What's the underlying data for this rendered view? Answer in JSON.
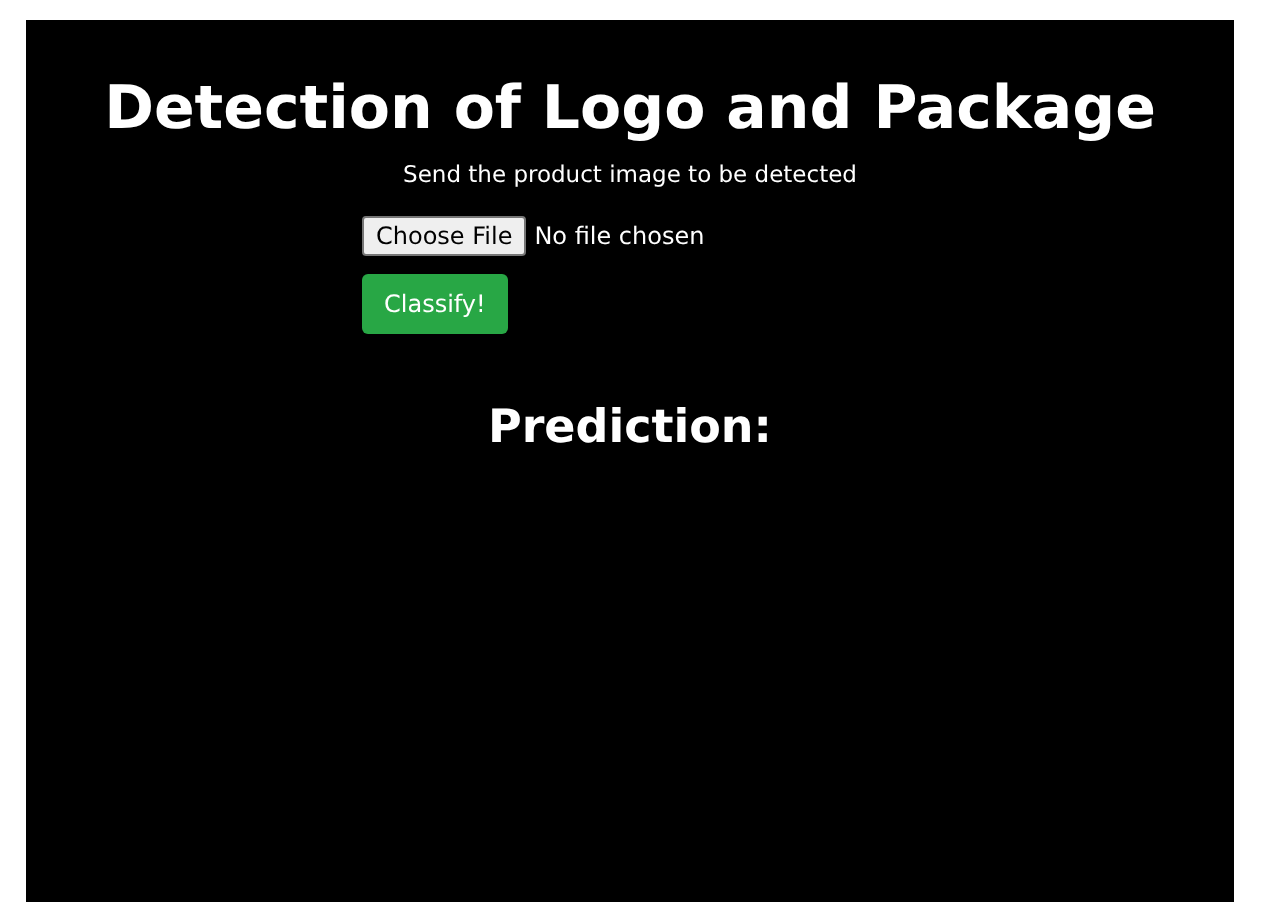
{
  "title": "Detection of Logo and Package",
  "subtitle": "Send the product image to be detected",
  "file_input": {
    "button": "Choose File",
    "status": "No file chosen"
  },
  "classify_button": "Classify!",
  "prediction_label": "Prediction:"
}
